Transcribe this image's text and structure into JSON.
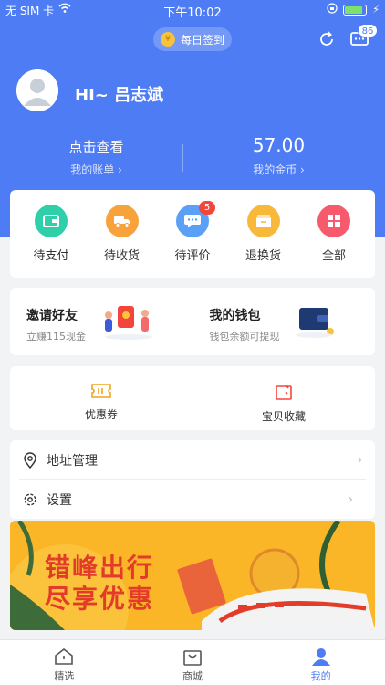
{
  "status_bar": {
    "carrier": "无 SIM 卡",
    "time": "下午10:02"
  },
  "header": {
    "signin_label": "每日签到",
    "message_count": "86",
    "greeting": "HI~ 吕志斌"
  },
  "account": {
    "bill_title": "点击查看",
    "bill_label": "我的账单 ›",
    "coins_value": "57.00",
    "coins_label": "我的金币 ›"
  },
  "orders": [
    {
      "label": "待支付",
      "icon": "wallet-icon",
      "color": "#2ecfa9"
    },
    {
      "label": "待收货",
      "icon": "truck-icon",
      "color": "#f8a23b"
    },
    {
      "label": "待评价",
      "icon": "comment-icon",
      "color": "#5aa0f6",
      "badge": "5"
    },
    {
      "label": "退换货",
      "icon": "return-box-icon",
      "color": "#f8b93b"
    },
    {
      "label": "全部",
      "icon": "grid-icon",
      "color": "#f65a6c"
    }
  ],
  "promo": {
    "invite_title": "邀请好友",
    "invite_sub": "立赚115现金",
    "wallet_title": "我的钱包",
    "wallet_sub": "钱包余额可提现"
  },
  "quick": {
    "coupon": "优惠券",
    "favorites": "宝贝收藏"
  },
  "settings_list": {
    "address": "地址管理",
    "settings": "设置"
  },
  "banner": {
    "line1": "错峰出行",
    "line2": "尽享优惠"
  },
  "tabs": {
    "home": "精选",
    "mall": "商城",
    "mine": "我的"
  },
  "colors": {
    "brand": "#4d7cf4",
    "badge": "#f2463b",
    "banner_bg": "#fbb628",
    "banner_text": "#e23b2a"
  }
}
